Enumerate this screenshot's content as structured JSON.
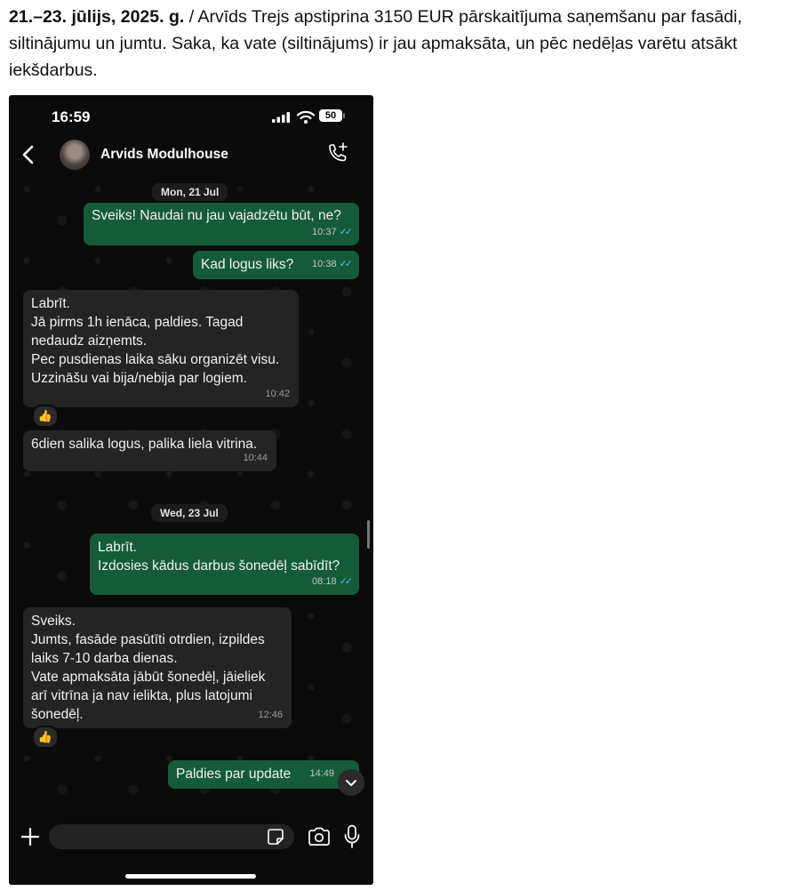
{
  "caption": {
    "dates": "21.–23. jūlijs, 2025. g.",
    "text": " / Arvīds Trejs apstiprina 3150 EUR pārskaitījuma saņemšanu par fasādi, siltinājumu un jumtu. Saka, ka vate (siltinājums) ir jau apmaksāta, un pēc nedēļas varētu atsākt iekšdarbus."
  },
  "status_bar": {
    "time": "16:59",
    "battery": "50"
  },
  "header": {
    "contact_name": "Arvids Modulhouse"
  },
  "chat": {
    "date_1": "Mon, 21 Jul",
    "date_2": "Wed, 23 Jul",
    "messages": [
      {
        "dir": "out",
        "text": "Sveiks! Naudai nu jau vajadzētu būt, ne?",
        "time": "10:37"
      },
      {
        "dir": "out",
        "text": "Kad logus liks?",
        "time": "10:38"
      },
      {
        "dir": "in",
        "text": "Labrīt.\nJā pirms 1h ienāca, paldies. Tagad nedaudz aizņemts.\nPec pusdienas laika sāku organizēt visu.\nUzzināšu vai bija/nebija par logiem.",
        "time": "10:42",
        "reaction": "👍"
      },
      {
        "dir": "in",
        "text": "6dien salika logus, palika liela vitrina.",
        "time": "10:44"
      },
      {
        "dir": "out",
        "text": "Labrīt.\nIzdosies kādus darbus šonedēļ sabīdīt?",
        "time": "08:18"
      },
      {
        "dir": "in",
        "text": "Sveiks.\nJumts, fasāde pasūtīti otrdien, izpildes laiks 7-10 darba dienas.\nVate apmaksāta jābūt šonedēļ, jāieliek arī vitrīna ja nav ielikta, plus latojumi šonedēļ.",
        "time": "12:46",
        "reaction": "👍"
      },
      {
        "dir": "out",
        "text": "Paldies par update",
        "time": "14:49"
      }
    ]
  },
  "composer": {
    "placeholder": ""
  },
  "icons": [
    "back-arrow-icon",
    "call-add-icon",
    "plus-icon",
    "sticker-icon",
    "camera-icon",
    "mic-icon",
    "chevron-down-icon",
    "signal-icon",
    "wifi-icon"
  ],
  "colors": {
    "outgoing_bubble": "#145c39",
    "incoming_bubble": "#242424",
    "read_ticks": "#53bdeb"
  }
}
